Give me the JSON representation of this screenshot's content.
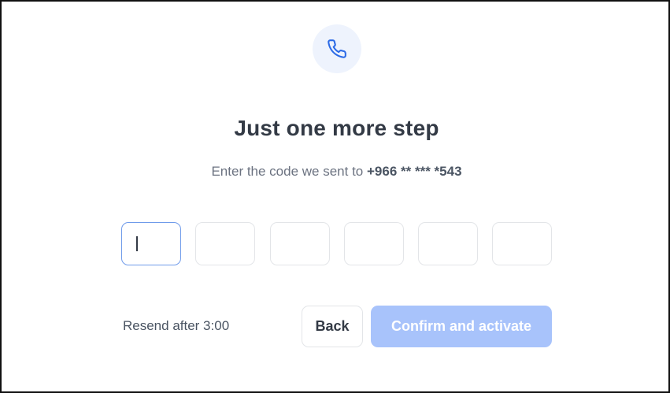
{
  "header": {
    "icon": "phone-icon",
    "title": "Just one more step",
    "subtitle_prefix": "Enter the code we sent to",
    "phone_masked": "+966 ** *** *543"
  },
  "otp": {
    "digits": [
      "",
      "",
      "",
      "",
      "",
      ""
    ],
    "active_index": 0
  },
  "footer": {
    "resend_text": "Resend after 3:00",
    "back_label": "Back",
    "confirm_label": "Confirm and activate"
  },
  "colors": {
    "accent": "#2b6ae6",
    "icon_bg": "#eef3fd",
    "confirm_disabled_bg": "#a8c3fb",
    "active_border": "#6f9bea",
    "title_text": "#333a45"
  }
}
